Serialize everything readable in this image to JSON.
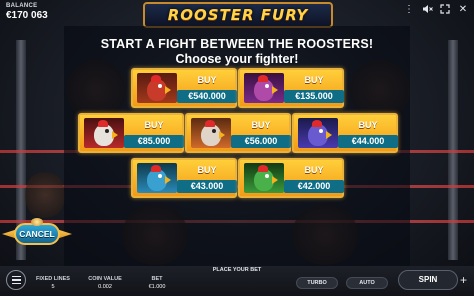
{
  "balance": {
    "label": "BALANCE",
    "value": "€170 063"
  },
  "logo": {
    "text": "ROOSTER FURY"
  },
  "top_icons": {
    "menu_icon": "more-vertical-icon",
    "sound_icon": "speaker-muted-icon",
    "fullscreen_icon": "fullscreen-icon",
    "close_icon": "close-icon"
  },
  "dialog": {
    "title_line1": "START A FIGHT BETWEEN THE ROOSTERS!",
    "title_line2": "Choose your fighter!",
    "buy_label": "BUY",
    "fighters": [
      {
        "price": "€540.000",
        "color": "#c83a2a"
      },
      {
        "price": "€135.000",
        "color": "#7a2a8a"
      },
      {
        "price": "€85.000",
        "color": "#b82a2a"
      },
      {
        "price": "€56.000",
        "color": "#d06a2a"
      },
      {
        "price": "€44.000",
        "color": "#4a3ab0"
      },
      {
        "price": "€43.000",
        "color": "#2a8ab8"
      },
      {
        "price": "€42.000",
        "color": "#3a9a3a"
      }
    ]
  },
  "cancel": {
    "label": "CANCEL"
  },
  "bottom": {
    "place_bet": "PLACE YOUR BET",
    "fixed_lines": {
      "label": "FIXED LINES",
      "value": "5"
    },
    "coin_value": {
      "label": "COIN VALUE",
      "value": "0.002"
    },
    "bet": {
      "label": "BET",
      "value": "€1.000"
    },
    "turbo": "TURBO",
    "auto": "AUTO",
    "spin": "SPIN",
    "plus": "+"
  },
  "colors": {
    "card_gold": "#f5a81f",
    "price_teal": "#0f6d86",
    "cancel_blue": "#1f86b8"
  }
}
